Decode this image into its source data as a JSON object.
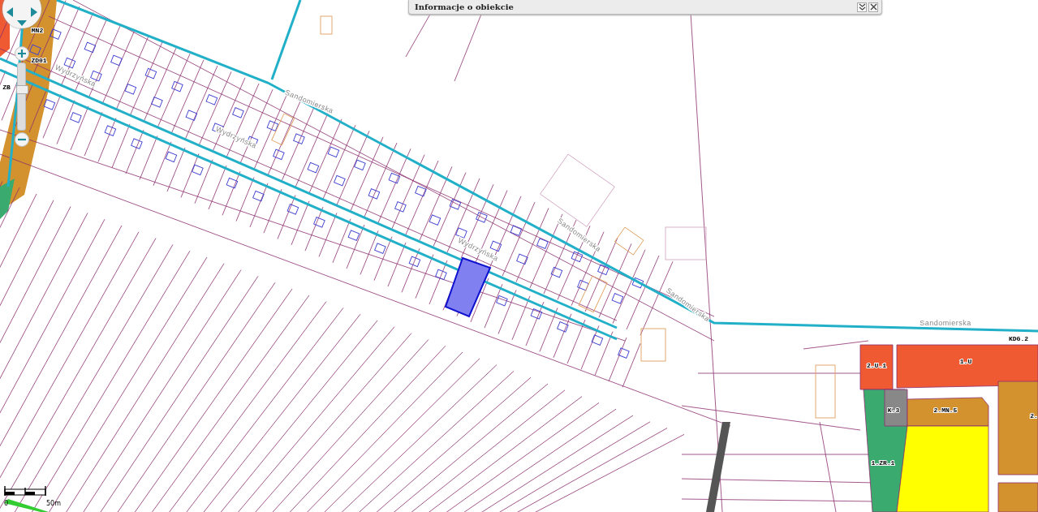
{
  "info_panel": {
    "title": "Informacje o obiekcie"
  },
  "street_labels": [
    {
      "text": "Sandomierska"
    },
    {
      "text": "Sandomierska"
    },
    {
      "text": "Sandomierska"
    },
    {
      "text": "Sandomierska"
    },
    {
      "text": "Wydrzyńska"
    },
    {
      "text": "Wydrzyńska"
    },
    {
      "text": "Wydrzyńska"
    }
  ],
  "zone_labels": [
    {
      "text": "MN2"
    },
    {
      "text": "ZD01"
    },
    {
      "text": "ZB"
    },
    {
      "text": "KDG.2"
    },
    {
      "text": "2.U.1"
    },
    {
      "text": "1.U"
    },
    {
      "text": "K.3"
    },
    {
      "text": "2.MN.5"
    },
    {
      "text": "1.ZR.1"
    },
    {
      "text": "2."
    }
  ],
  "zoom": {
    "level": 0.6
  },
  "scale_bar": {
    "start": "0",
    "end": "50m"
  }
}
